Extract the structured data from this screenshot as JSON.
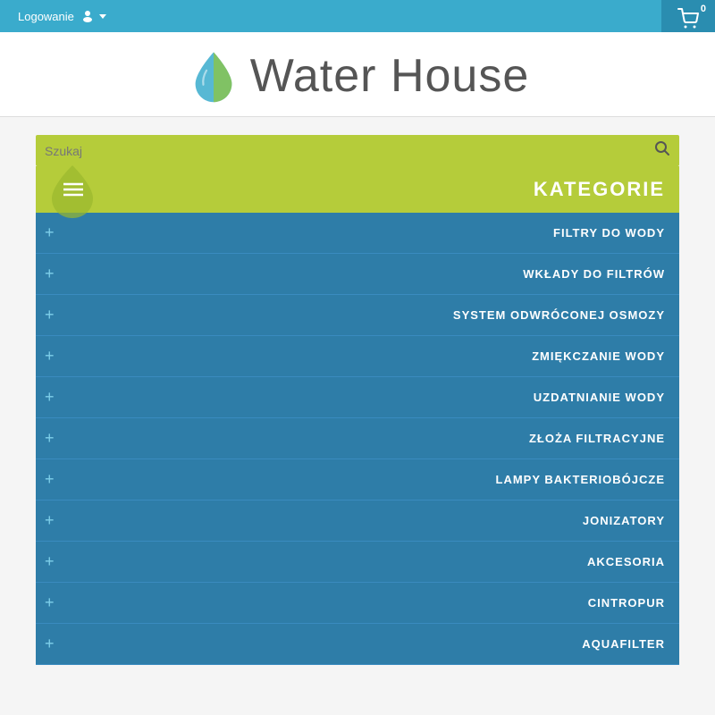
{
  "topbar": {
    "login_label": "Logowanie",
    "cart_count": "0",
    "accent_color": "#3aabcc"
  },
  "logo": {
    "site_name": "Water House",
    "first_word": "Water",
    "second_word": "House"
  },
  "search": {
    "placeholder": "Szukaj"
  },
  "categories": {
    "heading": "KATEGORIE",
    "items": [
      {
        "label": "FILTRY DO WODY"
      },
      {
        "label": "WKŁADY DO FILTRÓW"
      },
      {
        "label": "SYSTEM ODWRÓCONEJ OSMOZY"
      },
      {
        "label": "ZMIĘKCZANIE WODY"
      },
      {
        "label": "UZDATNIANIE WODY"
      },
      {
        "label": "ZŁOŻA FILTRACYJNE"
      },
      {
        "label": "LAMPY BAKTERIOBÓJCZE"
      },
      {
        "label": "JONIZATORY"
      },
      {
        "label": "AKCESORIA"
      },
      {
        "label": "CINTROPUR"
      },
      {
        "label": "AQUAFILTER"
      }
    ],
    "plus_icon": "+"
  }
}
